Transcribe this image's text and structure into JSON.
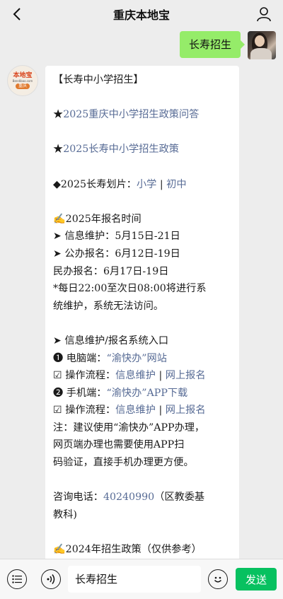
{
  "header": {
    "title": "重庆本地宝"
  },
  "outgoing": {
    "text": "长寿招生"
  },
  "bot": {
    "logo_main": "本地宝",
    "logo_sub": "Bendibao.com",
    "logo_city": "重庆"
  },
  "message": {
    "l1": "【长寿中小学招生】",
    "l2_star": "★",
    "l2_link": "2025重庆中小学招生政策问答",
    "l3_star": "★",
    "l3_link": "2025长寿中小学招生政策",
    "l4_prefix": "◆2025长寿划片：",
    "l4_link1": "小学",
    "l4_sep": " | ",
    "l4_link2": "初中",
    "l5": "✍2025年报名时间",
    "l6": "➤ 信息维护：5月15日-21日",
    "l7": "➤ 公办报名：6月12日-19日",
    "l8": "民办报名：6月17日-19日",
    "l9": "*每日22:00至次日08:00将进行系",
    "l10": "统维护，系统无法访问。",
    "l11": "➤ 信息维护/报名系统入口",
    "l12_prefix": "❶ 电脑端：",
    "l12_link": "“渝快办”网站",
    "l13_prefix": "☑ 操作流程：",
    "l13_link1": "信息维护",
    "l13_sep": " | ",
    "l13_link2": "网上报名",
    "l14_prefix": "❷ 手机端：",
    "l14_link": "“渝快办”APP下载",
    "l15_prefix": "☑ 操作流程：",
    "l15_link1": "信息维护",
    "l15_sep": " | ",
    "l15_link2": "网上报名",
    "l16": "注：建议使用“渝快办”APP办理，",
    "l17": "网页端办理也需要使用APP扫",
    "l18": "码验证，直接手机办理更方便。",
    "l19_prefix": "咨询电话：",
    "l19_link": "40240990",
    "l19_suffix": "（区教委基",
    "l20": "教科)",
    "l21": "✍2024年招生政策（仅供参考）"
  },
  "input": {
    "text": "长寿招生",
    "send_label": "发送"
  },
  "colors": {
    "link": "#576b95",
    "bubble_out": "#95ec69",
    "send": "#07c160"
  }
}
